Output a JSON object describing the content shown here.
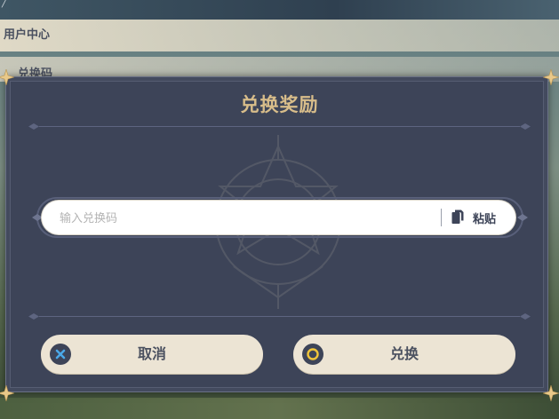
{
  "background": {
    "menu_user_center": "用户中心",
    "menu_redeem": "兑换码"
  },
  "dialog": {
    "title": "兑换奖励",
    "code_input": {
      "placeholder": "输入兑换码",
      "value": ""
    },
    "paste_label": "粘贴",
    "cancel_label": "取消",
    "confirm_label": "兑换"
  },
  "colors": {
    "panel": "#3d4458",
    "title_gold": "#d8bd8a",
    "button_bg": "#ece4d4",
    "cancel_icon_blue": "#4aa8e8",
    "confirm_icon_yellow": "#f0c53a"
  },
  "icons": {
    "paste": "paste-icon",
    "cancel": "cross-icon",
    "confirm": "circle-icon",
    "corner": "star-corner-icon"
  }
}
